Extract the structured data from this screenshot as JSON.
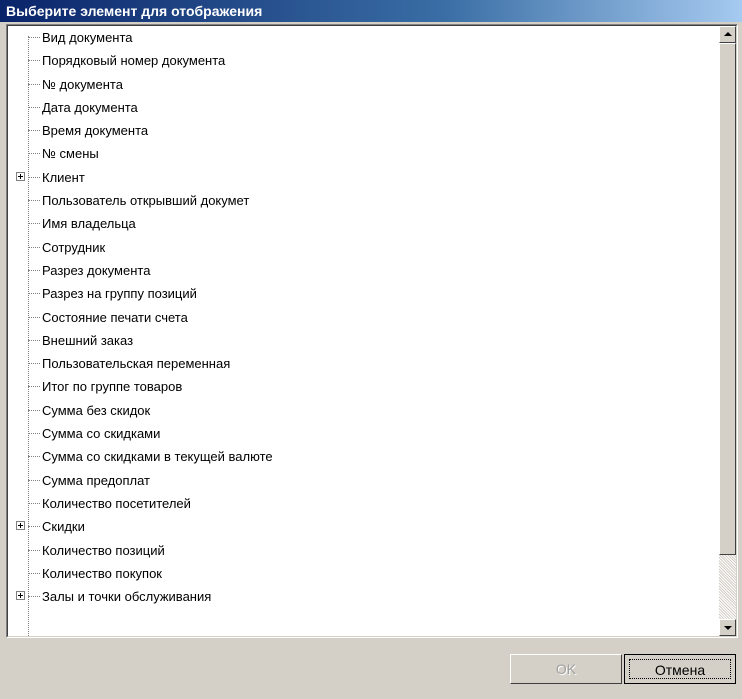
{
  "window": {
    "title": "Выберите элемент для отображения"
  },
  "tree": {
    "items": [
      {
        "label": "Вид документа",
        "expandable": false
      },
      {
        "label": "Порядковый номер документа",
        "expandable": false
      },
      {
        "label": "№ документа",
        "expandable": false
      },
      {
        "label": "Дата документа",
        "expandable": false
      },
      {
        "label": "Время документа",
        "expandable": false
      },
      {
        "label": "№ смены",
        "expandable": false
      },
      {
        "label": "Клиент",
        "expandable": true
      },
      {
        "label": "Пользователь открывший докумет",
        "expandable": false
      },
      {
        "label": "Имя владельца",
        "expandable": false
      },
      {
        "label": "Сотрудник",
        "expandable": false
      },
      {
        "label": "Разрез документа",
        "expandable": false
      },
      {
        "label": "Разрез на группу позиций",
        "expandable": false
      },
      {
        "label": "Состояние печати счета",
        "expandable": false
      },
      {
        "label": "Внешний заказ",
        "expandable": false
      },
      {
        "label": "Пользовательская переменная",
        "expandable": false
      },
      {
        "label": "Итог по группе товаров",
        "expandable": false
      },
      {
        "label": "Сумма без скидок",
        "expandable": false
      },
      {
        "label": "Сумма со скидками",
        "expandable": false
      },
      {
        "label": "Сумма со скидками в текущей валюте",
        "expandable": false
      },
      {
        "label": "Сумма предоплат",
        "expandable": false
      },
      {
        "label": "Количество посетителей",
        "expandable": false
      },
      {
        "label": "Скидки",
        "expandable": true
      },
      {
        "label": "Количество позиций",
        "expandable": false
      },
      {
        "label": "Количество покупок",
        "expandable": false
      },
      {
        "label": "Залы и точки обслуживания",
        "expandable": true
      }
    ]
  },
  "buttons": {
    "ok_label": "OK",
    "ok_enabled": false,
    "cancel_label": "Отмена"
  }
}
